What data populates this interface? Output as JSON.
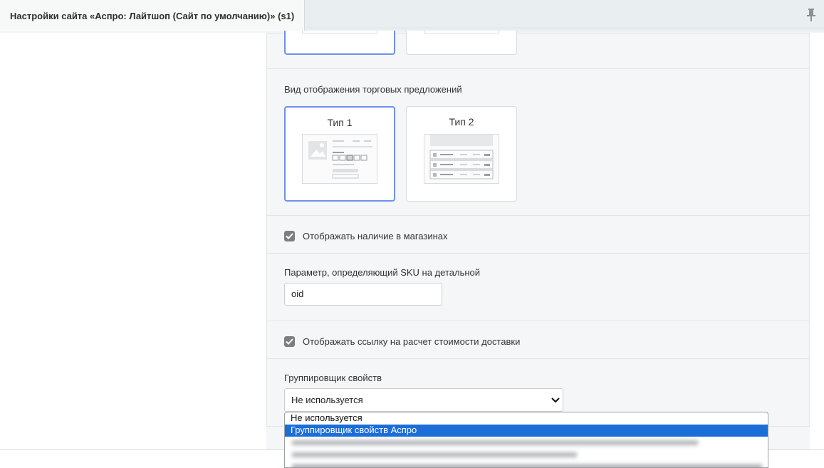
{
  "window": {
    "tab_title": "Настройки сайта «Аспро: Лайтшоп (Сайт по умолчанию)» (s1)",
    "pin_icon": "pin-icon"
  },
  "offers_view": {
    "label": "Вид отображения торговых предложений",
    "options": [
      {
        "title": "Тип 1",
        "selected": true
      },
      {
        "title": "Тип 2",
        "selected": false
      }
    ]
  },
  "show_stores": {
    "label": "Отображать наличие в магазинах",
    "checked": true
  },
  "sku_param": {
    "label": "Параметр, определяющий SKU на детальной",
    "value": "oid"
  },
  "show_delivery": {
    "label": "Отображать ссылку на расчет стоимости доставки",
    "checked": true
  },
  "grouper": {
    "label": "Группировщик свойств",
    "selected": "Не используется",
    "options": [
      "Не используется",
      "Группировщик свойств Аспро"
    ],
    "highlighted_index": 1
  },
  "colors": {
    "accent_border": "#6d8ff0",
    "highlight": "#1b6ed8",
    "checkbox": "#7b7f83"
  }
}
